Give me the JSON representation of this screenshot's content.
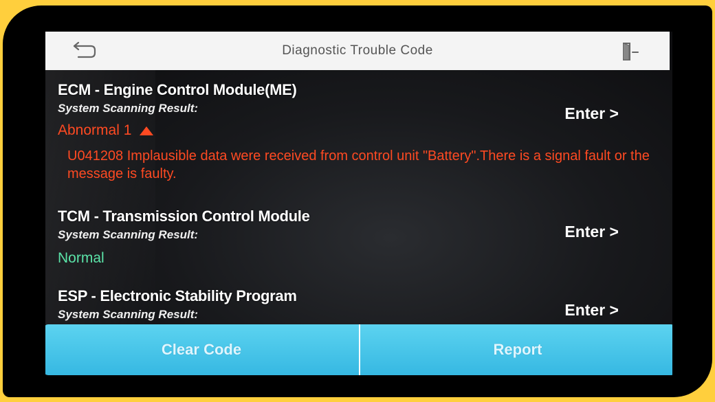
{
  "header": {
    "title": "Diagnostic Trouble Code",
    "back_icon": "back-arrow-icon",
    "exit_icon": "exit-door-icon"
  },
  "modules": [
    {
      "title": "ECM - Engine Control Module(ME)",
      "result_label": "System Scanning Result:",
      "status": "Abnormal 1",
      "status_color": "#ff4a22",
      "status_icon": "warning-triangle-icon",
      "fault_text": "U041208 Implausible data were received from control unit \"Battery\".There is a signal fault or the message is faulty.",
      "enter_label": "Enter >"
    },
    {
      "title": "TCM - Transmission Control Module",
      "result_label": "System Scanning Result:",
      "status": "Normal",
      "status_color": "#5be3a8",
      "enter_label": "Enter >"
    },
    {
      "title": "ESP - Electronic Stability Program",
      "result_label": "System Scanning Result:",
      "enter_label": "Enter >"
    }
  ],
  "buttons": {
    "clear_code": "Clear Code",
    "report": "Report"
  },
  "colors": {
    "frame": "#ffcf3d",
    "button": "#45c3e9",
    "abnormal": "#ff4a22",
    "normal": "#5be3a8"
  }
}
